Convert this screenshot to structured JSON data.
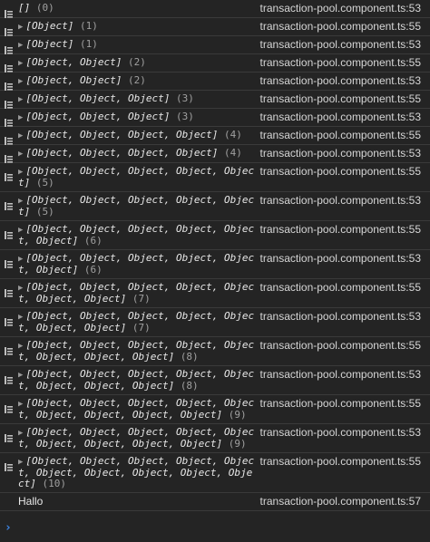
{
  "logs": [
    {
      "message": "[]",
      "count": "(0)",
      "source": "transaction-pool.component.ts:53",
      "expandable": false,
      "lines": 1
    },
    {
      "message": "[Object]",
      "count": "(1)",
      "source": "transaction-pool.component.ts:55",
      "expandable": true,
      "lines": 1
    },
    {
      "message": "[Object]",
      "count": "(1)",
      "source": "transaction-pool.component.ts:53",
      "expandable": true,
      "lines": 1
    },
    {
      "message": "[Object, Object]",
      "count": "(2)",
      "source": "transaction-pool.component.ts:55",
      "expandable": true,
      "lines": 1
    },
    {
      "message": "[Object, Object]",
      "count": "(2)",
      "source": "transaction-pool.component.ts:53",
      "expandable": true,
      "lines": 1
    },
    {
      "message": "[Object, Object, Object]",
      "count": "(3)",
      "source": "transaction-pool.component.ts:55",
      "expandable": true,
      "lines": 1
    },
    {
      "message": "[Object, Object, Object]",
      "count": "(3)",
      "source": "transaction-pool.component.ts:53",
      "expandable": true,
      "lines": 1
    },
    {
      "message": "[Object, Object, Object, Object]",
      "count": "(4)",
      "source": "transaction-pool.component.ts:55",
      "expandable": true,
      "lines": 1
    },
    {
      "message": "[Object, Object, Object, Object]",
      "count": "(4)",
      "source": "transaction-pool.component.ts:53",
      "expandable": true,
      "lines": 1
    },
    {
      "message": "[Object, Object, Object, Object, Object]",
      "count": "(5)",
      "source": "transaction-pool.component.ts:55",
      "expandable": true,
      "lines": 2
    },
    {
      "message": "[Object, Object, Object, Object, Object]",
      "count": "(5)",
      "source": "transaction-pool.component.ts:53",
      "expandable": true,
      "lines": 2
    },
    {
      "message": "[Object, Object, Object, Object, Object, Object]",
      "count": "(6)",
      "source": "transaction-pool.component.ts:55",
      "expandable": true,
      "lines": 2
    },
    {
      "message": "[Object, Object, Object, Object, Object, Object]",
      "count": "(6)",
      "source": "transaction-pool.component.ts:53",
      "expandable": true,
      "lines": 2
    },
    {
      "message": "[Object, Object, Object, Object, Object, Object, Object]",
      "count": "(7)",
      "source": "transaction-pool.component.ts:55",
      "expandable": true,
      "lines": 2
    },
    {
      "message": "[Object, Object, Object, Object, Object, Object, Object]",
      "count": "(7)",
      "source": "transaction-pool.component.ts:53",
      "expandable": true,
      "lines": 2
    },
    {
      "message": "[Object, Object, Object, Object, Object, Object, Object, Object]",
      "count": "(8)",
      "source": "transaction-pool.component.ts:55",
      "expandable": true,
      "lines": 2
    },
    {
      "message": "[Object, Object, Object, Object, Object, Object, Object, Object]",
      "count": "(8)",
      "source": "transaction-pool.component.ts:53",
      "expandable": true,
      "lines": 2
    },
    {
      "message": "[Object, Object, Object, Object, Object, Object, Object, Object, Object]",
      "count": "(9)",
      "source": "transaction-pool.component.ts:55",
      "expandable": true,
      "lines": 2
    },
    {
      "message": "[Object, Object, Object, Object, Object, Object, Object, Object, Object]",
      "count": "(9)",
      "source": "transaction-pool.component.ts:53",
      "expandable": true,
      "lines": 2
    },
    {
      "message": "[Object, Object, Object, Object, Object, Object, Object, Object, Object, Object]",
      "count": "(10)",
      "source": "transaction-pool.component.ts:55",
      "expandable": true,
      "lines": 3
    }
  ],
  "plain_log": {
    "message": "Hallo",
    "source": "transaction-pool.component.ts:57"
  },
  "prompt_symbol": "›",
  "colors": {
    "background": "#242424",
    "prompt": "#3d86e6",
    "count": "#a0a0a0"
  }
}
